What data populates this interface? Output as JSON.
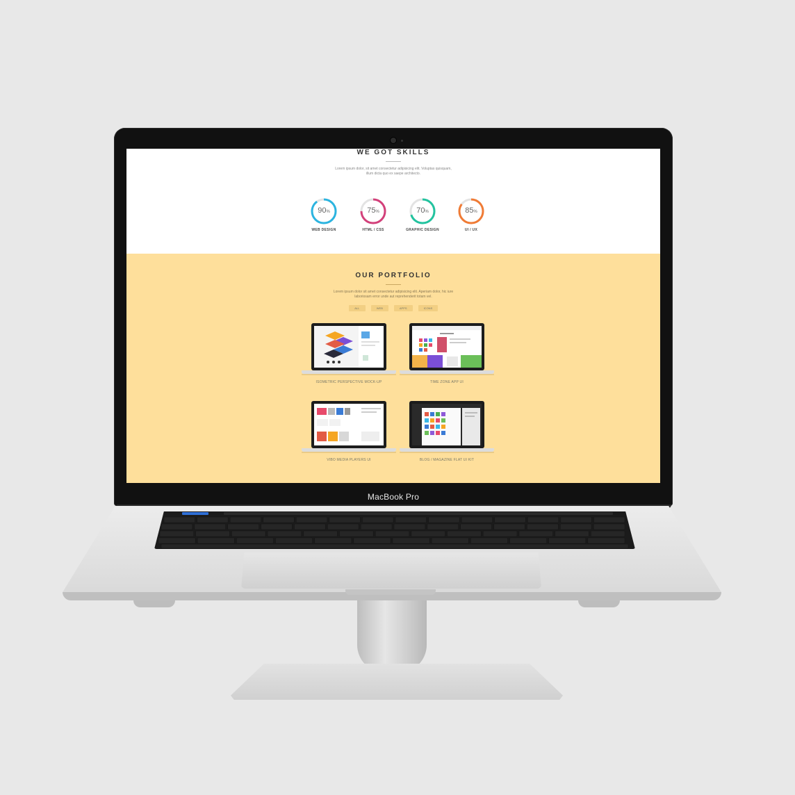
{
  "device": {
    "brand_label": "MacBook Pro"
  },
  "skills": {
    "title": "WE GOT SKILLS",
    "lead_line1": "Lorem ipsum dolor, sit amet consectetur adipisicing elit. Voluptas quisquam,",
    "lead_line2": "illum dicta quo ex saepe architecto.",
    "items": [
      {
        "value": "90",
        "unit": "%",
        "label": "WEB DESIGN",
        "percent": 90,
        "color": "#2bb4e0"
      },
      {
        "value": "75",
        "unit": "%",
        "label": "HTML / CSS",
        "percent": 75,
        "color": "#d3407a"
      },
      {
        "value": "70",
        "unit": "%",
        "label": "GRAPHIC DESIGN",
        "percent": 70,
        "color": "#22c39f"
      },
      {
        "value": "85",
        "unit": "%",
        "label": "UI / UX",
        "percent": 85,
        "color": "#f07b35"
      }
    ]
  },
  "portfolio": {
    "title": "OUR PORTFOLIO",
    "lead_line1": "Lorem ipsum dolor sit amet consectetur adipisicing elit. Aperiam dolor, hic iure",
    "lead_line2": "laboriosam error unde aut reprehenderit totam vel.",
    "filters": [
      "ALL",
      "WEB",
      "APPS",
      "ICONS"
    ],
    "items": [
      {
        "caption": "ISOMETRIC PERSPECTIVE MOCK-UP"
      },
      {
        "caption": "TIME ZONE APP UI"
      },
      {
        "caption": "VIBO MEDIA PLAYERS UI"
      },
      {
        "caption": "BLOG / MAGAZINE FLAT UI KIT"
      }
    ]
  },
  "colors": {
    "portfolio_bg": "#fedf9b",
    "page_bg": "#e8e8e8"
  }
}
